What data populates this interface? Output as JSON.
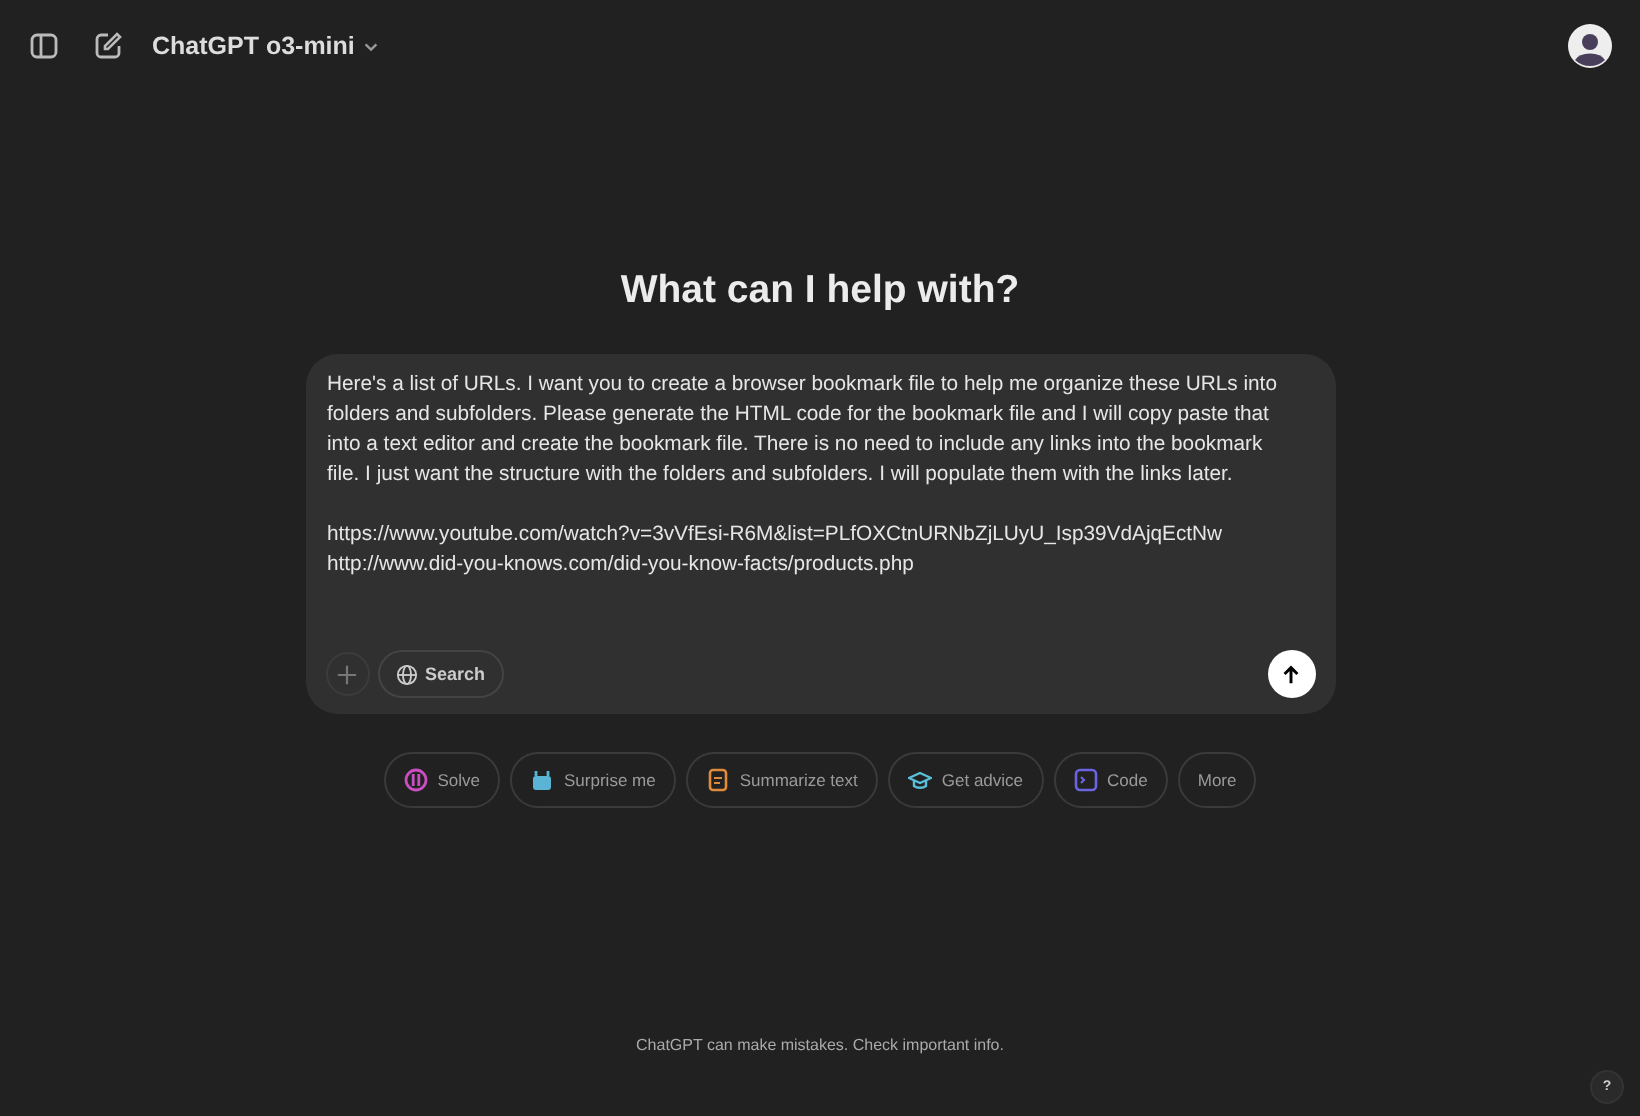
{
  "header": {
    "model": "ChatGPT o3-mini"
  },
  "heading": "What can I help with?",
  "composer": {
    "prompt": "Here's a list of URLs. I want you to create a browser bookmark file to help me organize these URLs into folders and subfolders. Please generate the HTML code for the bookmark file and I will copy paste that into a text editor and create the bookmark file. There is no need to include any links into the bookmark file. I just want the structure with the folders and subfolders. I will populate them with the links later.",
    "urls": [
      "https://www.youtube.com/watch?v=3vVfEsi-R6M&list=PLfOXCtnURNbZjLUyU_Isp39VdAjqEctNw",
      "http://www.did-you-knows.com/did-you-know-facts/products.php"
    ],
    "search_label": "Search"
  },
  "suggestions": [
    {
      "label": "Solve",
      "kind": "solve",
      "color": "#c94fc0"
    },
    {
      "label": "Surprise me",
      "kind": "gift",
      "color": "#5ab4d6"
    },
    {
      "label": "Summarize text",
      "kind": "doc",
      "color": "#e08a3c"
    },
    {
      "label": "Get advice",
      "kind": "cap",
      "color": "#5ac0d9"
    },
    {
      "label": "Code",
      "kind": "code",
      "color": "#6a64e0"
    },
    {
      "label": "More",
      "kind": "more"
    }
  ],
  "footer": "ChatGPT can make mistakes. Check important info.",
  "help": "?"
}
